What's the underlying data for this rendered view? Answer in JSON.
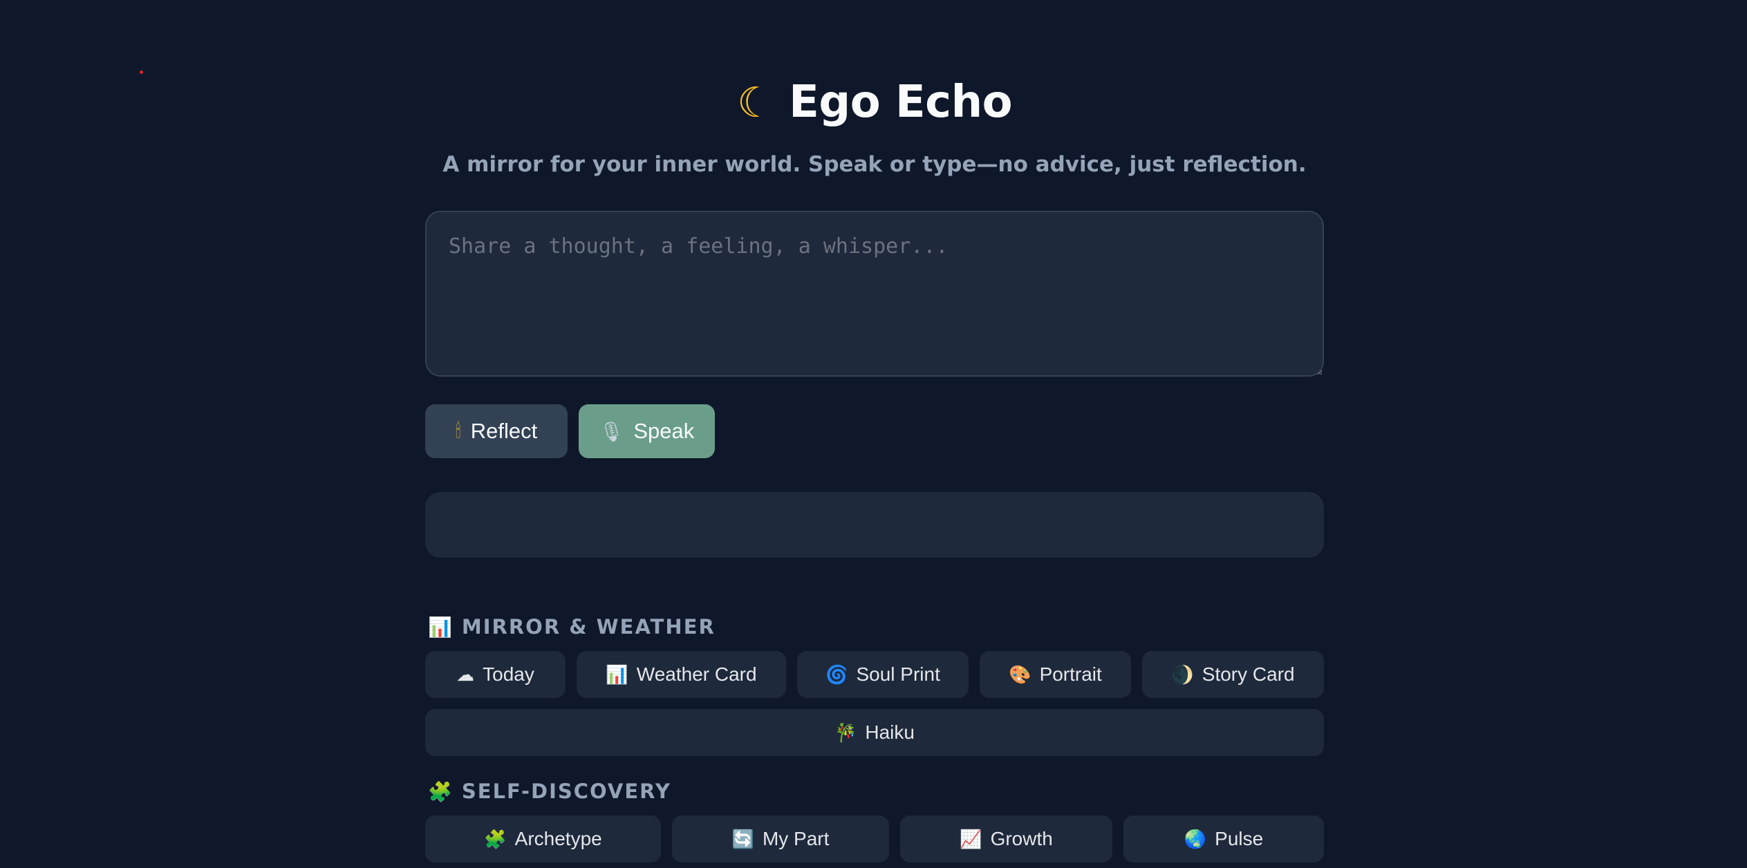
{
  "header": {
    "title_icon": "moon-icon",
    "title": "Ego Echo",
    "subtitle": "A mirror for your inner world. Speak or type—no advice, just reflection."
  },
  "input": {
    "placeholder": "Share a thought, a feeling, a whisper...",
    "value": ""
  },
  "actions": {
    "reflect": {
      "icon": "candle-icon",
      "label": "Reflect"
    },
    "speak": {
      "icon": "microphone-icon",
      "label": "Speak"
    }
  },
  "output": {
    "text": ""
  },
  "sections": {
    "mirror_weather": {
      "icon": "bar-chart-icon",
      "title": "MIRROR & WEATHER",
      "items": [
        {
          "icon": "cloud-icon",
          "label": "Today"
        },
        {
          "icon": "bar-chart-icon",
          "label": "Weather Card"
        },
        {
          "icon": "spiral-icon",
          "label": "Soul Print"
        },
        {
          "icon": "palette-icon",
          "label": "Portrait"
        },
        {
          "icon": "crescent-ball-icon",
          "label": "Story Card"
        },
        {
          "icon": "bamboo-icon",
          "label": "Haiku"
        }
      ]
    },
    "self_discovery": {
      "icon": "puzzle-icon",
      "title": "SELF-DISCOVERY",
      "items": [
        {
          "icon": "puzzle-icon",
          "label": "Archetype"
        },
        {
          "icon": "cycle-icon",
          "label": "My Part"
        },
        {
          "icon": "trend-chart-icon",
          "label": "Growth"
        },
        {
          "icon": "globe-icon",
          "label": "Pulse"
        }
      ]
    }
  },
  "colors": {
    "background": "#0f172a",
    "panel": "#1e293b",
    "reflect_button": "#334155",
    "speak_button": "#6b9e8a",
    "muted_text": "#94a3b8"
  }
}
